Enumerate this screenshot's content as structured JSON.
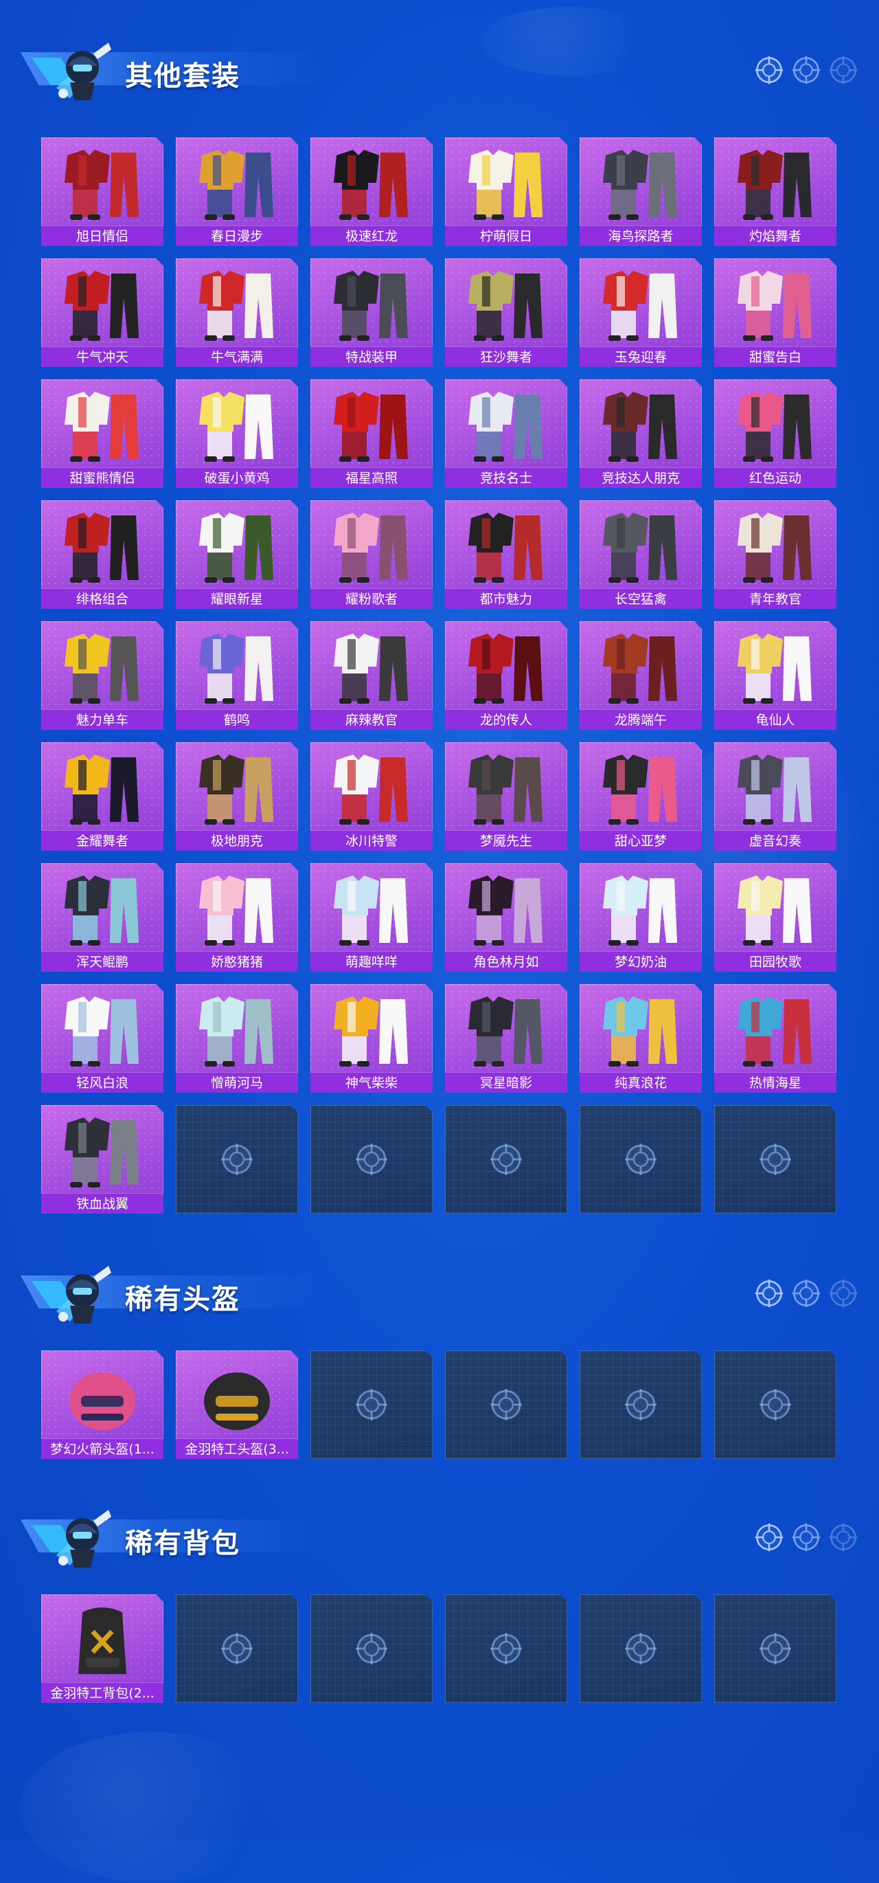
{
  "sections": [
    {
      "title": "其他套装",
      "items": [
        "旭日情侣",
        "春日漫步",
        "极速红龙",
        "柠萌假日",
        "海鸟探路者",
        "灼焰舞者",
        "牛气冲天",
        "牛气满满",
        "特战装甲",
        "狂沙舞者",
        "玉兔迎春",
        "甜蜜告白",
        "甜蜜熊情侣",
        "破蛋小黄鸡",
        "福星高照",
        "竞技名士",
        "竞技达人朋克",
        "红色运动",
        "绯格组合",
        "耀眼新星",
        "耀粉歌者",
        "都市魅力",
        "长空猛禽",
        "青年教官",
        "魅力单车",
        "鹤鸣",
        "麻辣教官",
        "龙的传人",
        "龙腾端午",
        "龟仙人",
        "金耀舞者",
        "极地朋克",
        "冰川特警",
        "梦魇先生",
        "甜心亚梦",
        "虚音幻奏",
        "浑天鲲鹏",
        "娇憨猪猪",
        "萌趣咩咩",
        "角色林月如",
        "梦幻奶油",
        "田园牧歌",
        "轻风白浪",
        "憎萌河马",
        "神气柴柴",
        "冥星暗影",
        "纯真浪花",
        "热情海星",
        "铁血战翼"
      ],
      "empty_slots": 5
    },
    {
      "title": "稀有头盔",
      "items": [
        "梦幻火箭头盔(1...",
        "金羽特工头盔(3..."
      ],
      "empty_slots": 4
    },
    {
      "title": "稀有背包",
      "items": [
        "金羽特工背包(2..."
      ],
      "empty_slots": 5
    }
  ],
  "colors": {
    "background": "#0d4fd0",
    "card_purple": "#a44fdf",
    "label_bar": "#8f2fe0",
    "empty_slot": "#1f3c68"
  },
  "icons": {
    "header_mascot": "helmet-character-icon",
    "header_decor": "crosshair-icon",
    "empty_slot": "crosshair-icon"
  }
}
